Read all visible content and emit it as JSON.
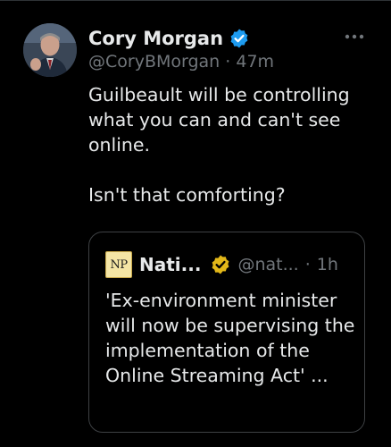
{
  "tweet": {
    "display_name": "Cory Morgan",
    "handle": "@CoryBMorgan",
    "separator": "·",
    "time": "47m",
    "text_line1": "Guilbeault will be controlling what you can and can't see online.",
    "text_line2": "Isn't that comforting?"
  },
  "quoted_tweet": {
    "logo_text": "NP",
    "display_name": "Nati...",
    "handle": "@nat...",
    "separator": "·",
    "time": "1h",
    "text": "'Ex-environment minister will now be supervising the implementation of the Online Streaming Act' ..."
  },
  "icons": {
    "verified": "verified-badge-icon",
    "gold_verified": "gold-verified-badge-icon",
    "more": "more-options-icon"
  },
  "colors": {
    "background": "#000000",
    "text_primary": "#e7e9ea",
    "text_secondary": "#71767b",
    "verified_blue": "#1d9bf0",
    "verified_gold": "#e2b719",
    "border": "#3e4144"
  }
}
